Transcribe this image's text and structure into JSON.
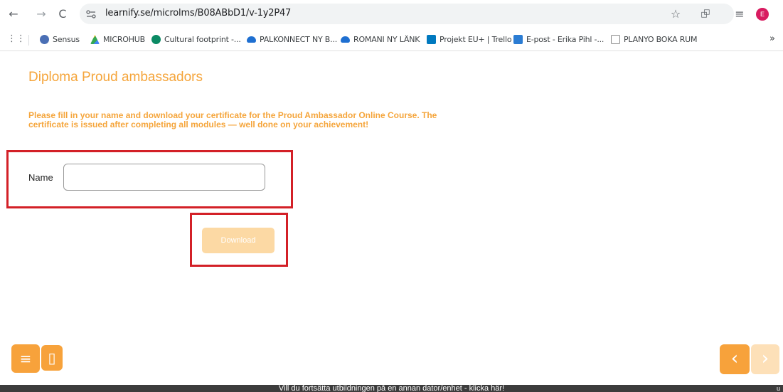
{
  "browser": {
    "url": "learnify.se/microlms/B08ABbD1/v-1y2P47",
    "avatar_letter": "E",
    "icons": {
      "back": "←",
      "forward": "→",
      "reload": "C",
      "star": "☆",
      "extensions": "⮺",
      "reading_list": "≡",
      "apps": "⋮⋮",
      "overflow": "»"
    }
  },
  "bookmarks": [
    {
      "label": "Sensus",
      "color": "#4a6fb5"
    },
    {
      "label": "MICROHUB",
      "color": "#34a853"
    },
    {
      "label": "Cultural footprint -...",
      "color": "#0b8a64"
    },
    {
      "label": "PALKONNECT NY B...",
      "color": "#1e6fd1"
    },
    {
      "label": "ROMANI NY LÄNK",
      "color": "#1e6fd1"
    },
    {
      "label": "Projekt EU+ | Trello",
      "color": "#0079bf"
    },
    {
      "label": "E-post - Erika Pihl -...",
      "color": "#2b7cd3"
    },
    {
      "label": "PLANYO BOKA RUM",
      "color": "#8a8a8a"
    }
  ],
  "page": {
    "title": "Diploma Proud ambassadors",
    "intro": "Please fill in your name and download your certificate for the Proud Ambassador Online Course. The certificate is issued after completing all modules — well done on your achievement!",
    "name_label": "Name",
    "name_value": "",
    "download_label": "Download"
  },
  "nav": {
    "menu_icon": "≡",
    "bookmark_icon": "▯",
    "prev_icon": "‹",
    "next_icon": "›"
  },
  "footer": {
    "text": "Vill du fortsätta utbildningen på en annan dator/enhet - klicka här!",
    "right": "u"
  },
  "colors": {
    "accent": "#f5a53b",
    "button_disabled": "#fcd9a4",
    "highlight": "#d32027",
    "footer_bg": "#3c3c3c"
  }
}
